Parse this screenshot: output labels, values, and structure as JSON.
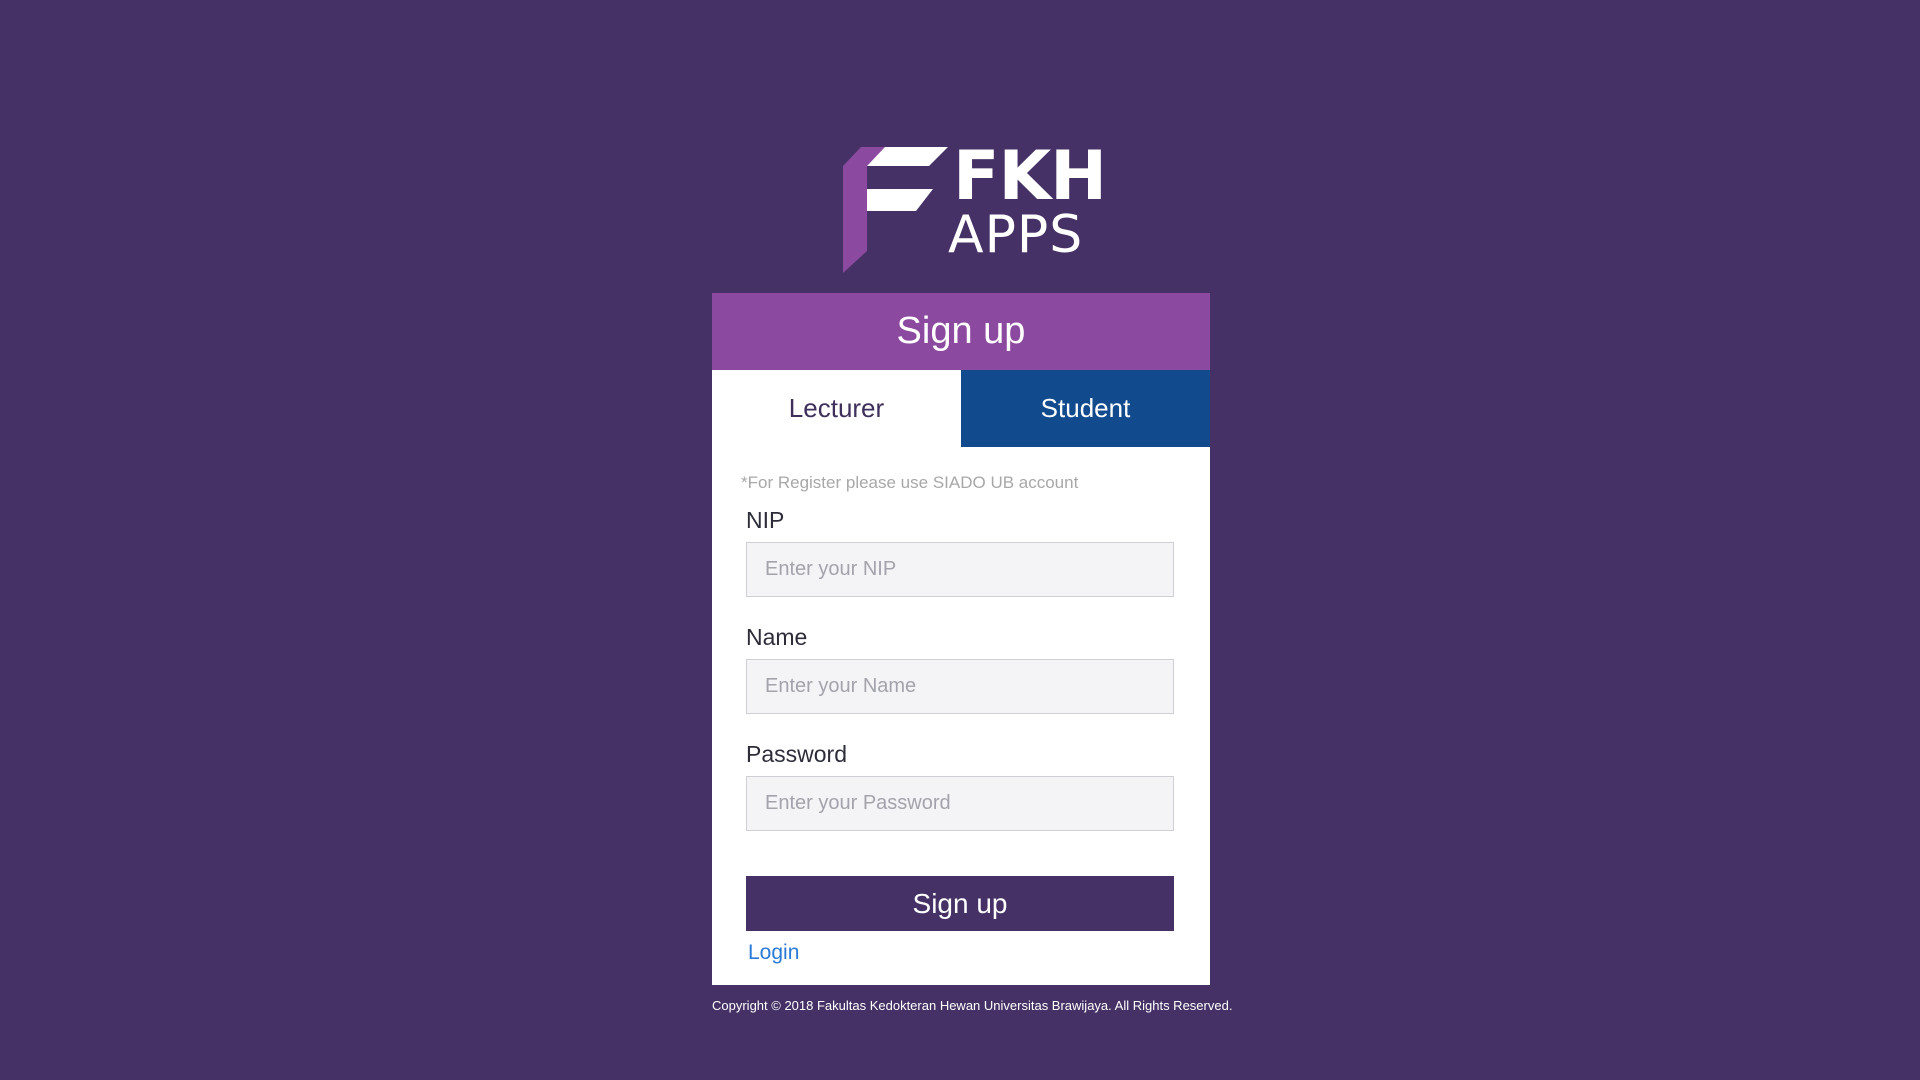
{
  "logo": {
    "icon": "fkh-f-logo-icon",
    "line1": "FKH",
    "line2": "APPS",
    "colors": {
      "purple": "#8b4a9f",
      "white": "#ffffff"
    }
  },
  "card": {
    "title": "Sign up",
    "tabs": [
      {
        "label": "Lecturer",
        "active": false
      },
      {
        "label": "Student",
        "active": true
      }
    ],
    "note": "*For Register please use SIADO UB account",
    "fields": [
      {
        "label": "NIP",
        "placeholder": "Enter your NIP",
        "value": ""
      },
      {
        "label": "Name",
        "placeholder": "Enter your Name",
        "value": ""
      },
      {
        "label": "Password",
        "placeholder": "Enter your Password",
        "value": ""
      }
    ],
    "submit_label": "Sign up",
    "login_link": "Login"
  },
  "footer": {
    "copyright": "Copyright © 2018 Fakultas Kedokteran Hewan  Universitas Brawijaya. All Rights Reserved."
  },
  "colors": {
    "background": "#453165",
    "header": "#8b4a9f",
    "active_tab": "#124a8e",
    "button": "#453165",
    "link": "#2a7ad6"
  }
}
